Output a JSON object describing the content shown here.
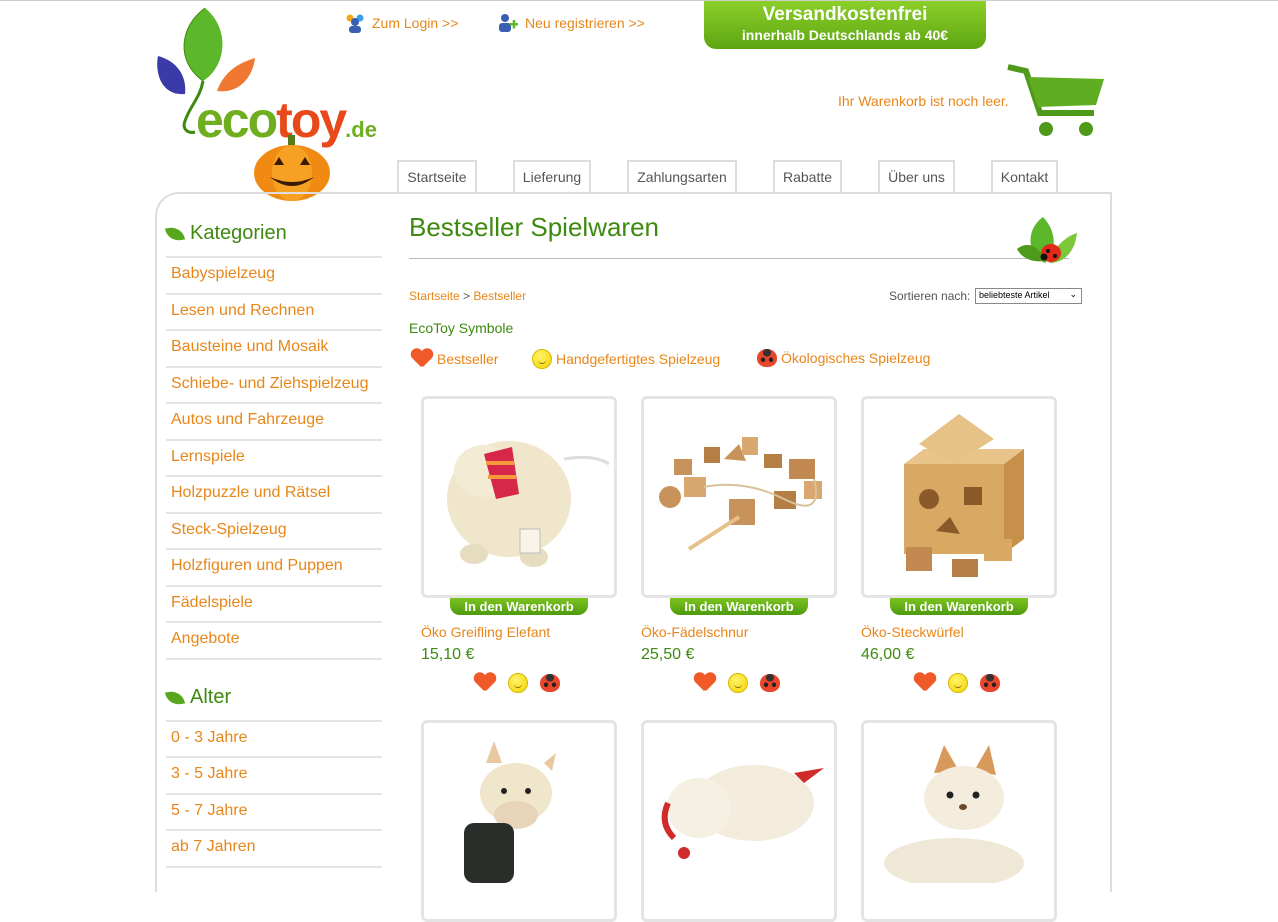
{
  "header": {
    "login": "Zum Login >>",
    "register": "Neu registrieren >>",
    "promo_line1": "Versandkostenfrei",
    "promo_line2": "innerhalb Deutschlands ab 40€",
    "logo_eco": "eco",
    "logo_toy": "toy",
    "logo_de": ".de",
    "cart_text": "Ihr Warenkorb ist noch leer."
  },
  "nav": [
    "Startseite",
    "Lieferung",
    "Zahlungsarten",
    "Rabatte",
    "Über uns",
    "Kontakt"
  ],
  "sidebar": {
    "categories_title": "Kategorien",
    "categories": [
      "Babyspielzeug",
      "Lesen und Rechnen",
      "Bausteine und Mosaik",
      "Schiebe- und Ziehspielzeug",
      "Autos und Fahrzeuge",
      "Lernspiele",
      "Holzpuzzle und Rätsel",
      "Steck-Spielzeug",
      "Holzfiguren und Puppen",
      "Fädelspiele",
      "Angebote"
    ],
    "age_title": "Alter",
    "ages": [
      "0 - 3 Jahre",
      "3 - 5 Jahre",
      "5 - 7 Jahre",
      "ab 7 Jahren"
    ]
  },
  "content": {
    "title": "Bestseller Spielwaren",
    "breadcrumb_home": "Startseite",
    "breadcrumb_sep": ">",
    "breadcrumb_current": "Bestseller",
    "sort_label": "Sortieren nach:",
    "sort_value": "beliebteste Artikel",
    "symbols_title": "EcoToy Symbole",
    "symbols": [
      "Bestseller",
      "Handgefertigtes Spielzeug",
      "Ökologisches Spielzeug"
    ],
    "cart_button": "In den Warenkorb",
    "products": [
      {
        "name": "Öko Greifling Elefant",
        "price": "15,10 €"
      },
      {
        "name": "Öko-Fädelschnur",
        "price": "25,50 €"
      },
      {
        "name": "Öko-Steckwürfel",
        "price": "46,00 €"
      }
    ]
  },
  "colors": {
    "orange": "#e8861a",
    "green": "#3e8a10",
    "accent_green": "#6fae1e"
  }
}
